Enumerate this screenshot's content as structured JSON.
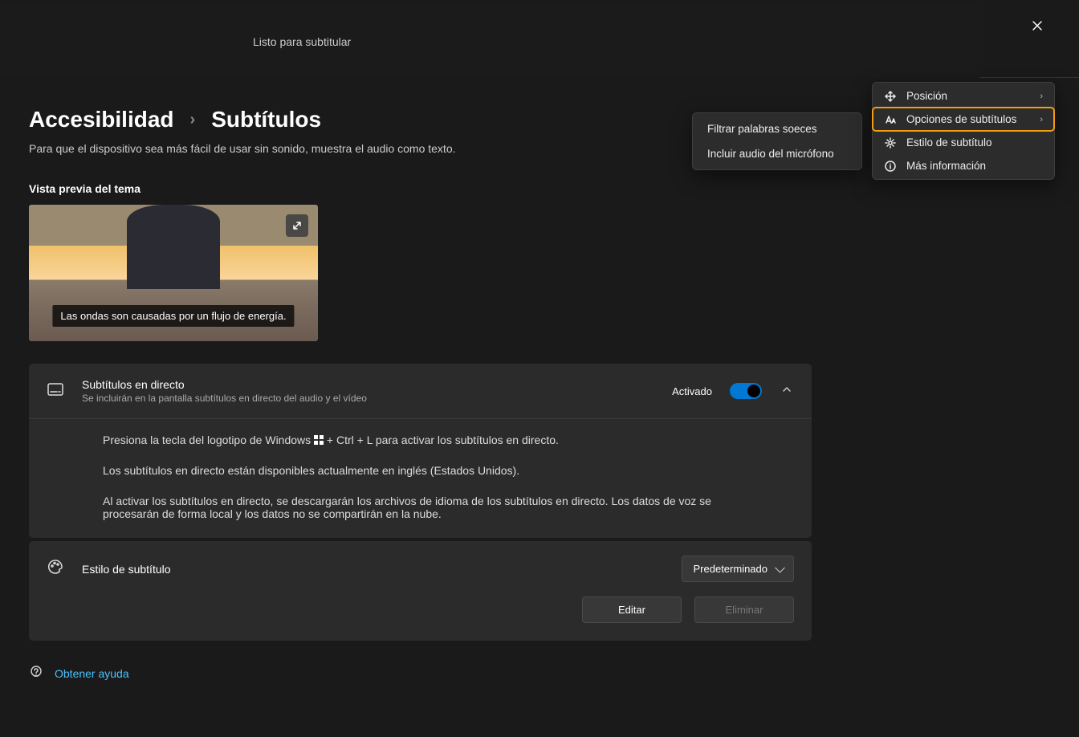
{
  "topbar": {
    "caption": "Listo para subtitular"
  },
  "breadcrumb": {
    "parent": "Accesibilidad",
    "current": "Subtítulos"
  },
  "page_sub": "Para que el dispositivo sea más fácil de usar sin sonido, muestra el audio como texto.",
  "preview": {
    "label": "Vista previa del tema",
    "caption": "Las ondas son causadas por un flujo de energía."
  },
  "live_captions": {
    "title": "Subtítulos en directo",
    "desc": "Se incluirán en la pantalla subtítulos en directo del audio y el vídeo",
    "state_label": "Activado",
    "body1a": "Presiona la tecla del logotipo de Windows ",
    "body1b": " + Ctrl + L para activar los subtítulos en directo.",
    "body2": "Los subtítulos en directo están disponibles actualmente en inglés (Estados Unidos).",
    "body3": "Al activar los subtítulos en directo, se descargarán los archivos de idioma de los subtítulos en directo. Los datos de voz se procesarán de forma local y los datos no se compartirán en la nube."
  },
  "style": {
    "title": "Estilo de subtítulo",
    "dropdown": "Predeterminado",
    "edit": "Editar",
    "delete": "Eliminar"
  },
  "help": "Obtener ayuda",
  "submenu": {
    "filter": "Filtrar palabras soeces",
    "mic": "Incluir audio del micrófono"
  },
  "menu": {
    "position": "Posición",
    "options": "Opciones de subtítulos",
    "style": "Estilo de subtítulo",
    "info": "Más información"
  }
}
